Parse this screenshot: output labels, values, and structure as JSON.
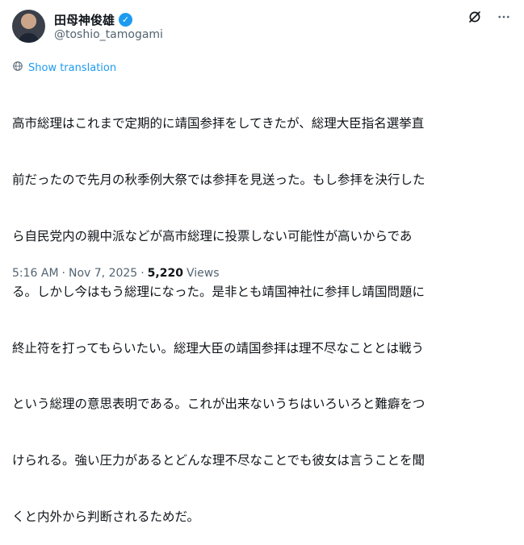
{
  "author": {
    "display_name": "田母神俊雄",
    "handle": "@toshio_tamogami",
    "verified_icon": "verified-badge-icon"
  },
  "actions": {
    "grok_icon": "grok-icon",
    "more_icon": "more-horizontal-icon"
  },
  "translation": {
    "label": "Show translation",
    "icon": "globe-icon"
  },
  "tweet": {
    "lines": [
      "高市総理はこれまで定期的に靖国参拝をしてきたが、総理大臣指名選挙直",
      "前だったので先月の秋季例大祭では参拝を見送った。もし参拝を決行した",
      "ら自民党内の親中派などが高市総理に投票しない可能性が高いからであ",
      "る。しかし今はもう総理になった。是非とも靖国神社に参拝し靖国問題に",
      "終止符を打ってもらいたい。総理大臣の靖国参拝は理不尽なこととは戦う",
      "という総理の意思表明である。これが出来ないうちはいろいろと難癖をつ",
      "けられる。強い圧力があるとどんな理不尽なことでも彼女は言うことを聞",
      "くと内外から判断されるためだ。"
    ]
  },
  "meta": {
    "time": "5:16 AM",
    "sep1": "·",
    "date": "Nov 7, 2025",
    "sep2": "·",
    "views_count": "5,220",
    "views_label": "Views"
  },
  "colors": {
    "accent": "#1d9bf0",
    "text": "#0f1419",
    "muted": "#536471"
  }
}
